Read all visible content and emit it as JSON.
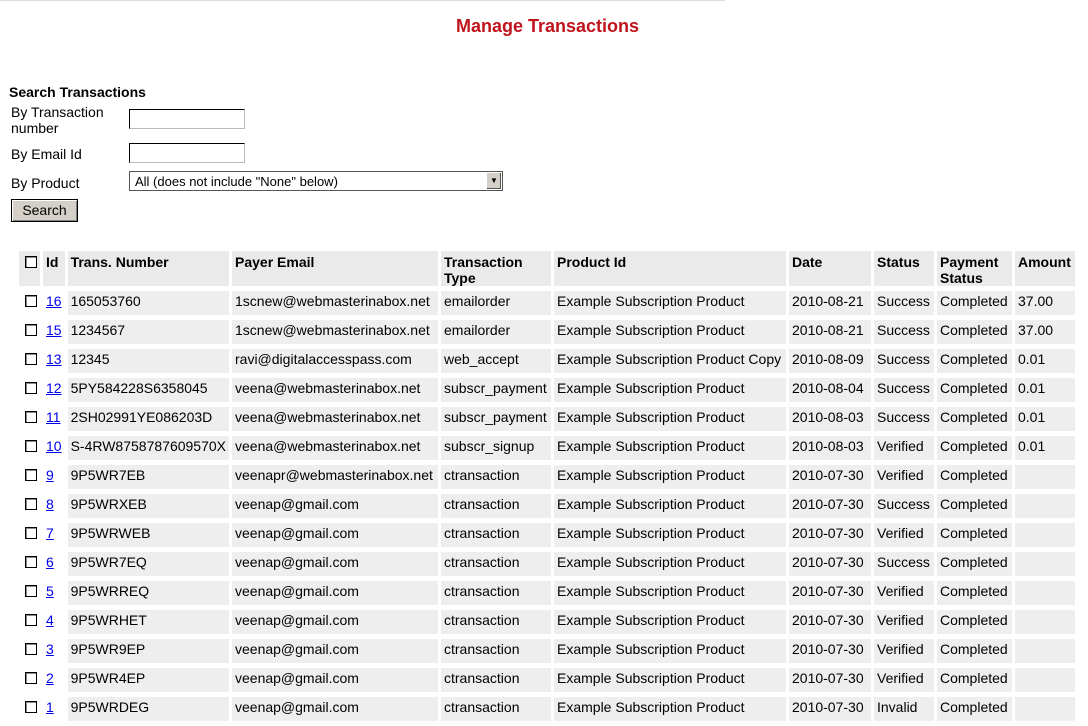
{
  "page": {
    "title": "Manage Transactions"
  },
  "search": {
    "heading": "Search Transactions",
    "transaction_label": "By Transaction number",
    "transaction_value": "",
    "email_label": "By Email Id",
    "email_value": "",
    "product_label": "By Product",
    "product_selected": "All (does not include \"None\" below)",
    "button_label": "Search"
  },
  "table": {
    "headers": [
      "Id",
      "Trans. Number",
      "Payer Email",
      "Transaction Type",
      "Product Id",
      "Date",
      "Status",
      "Payment Status",
      "Amount"
    ],
    "rows": [
      [
        "16",
        "165053760",
        "1scnew@webmasterinabox.net",
        "emailorder",
        "Example Subscription Product",
        "2010-08-21",
        "Success",
        "Completed",
        "37.00"
      ],
      [
        "15",
        "1234567",
        "1scnew@webmasterinabox.net",
        "emailorder",
        "Example Subscription Product",
        "2010-08-21",
        "Success",
        "Completed",
        "37.00"
      ],
      [
        "13",
        "12345",
        "ravi@digitalaccesspass.com",
        "web_accept",
        "Example Subscription Product Copy",
        "2010-08-09",
        "Success",
        "Completed",
        "0.01"
      ],
      [
        "12",
        "5PY584228S6358045",
        "veena@webmasterinabox.net",
        "subscr_payment",
        "Example Subscription Product",
        "2010-08-04",
        "Success",
        "Completed",
        "0.01"
      ],
      [
        "11",
        "2SH02991YE086203D",
        "veena@webmasterinabox.net",
        "subscr_payment",
        "Example Subscription Product",
        "2010-08-03",
        "Success",
        "Completed",
        "0.01"
      ],
      [
        "10",
        "S-4RW8758787609570X",
        "veena@webmasterinabox.net",
        "subscr_signup",
        "Example Subscription Product",
        "2010-08-03",
        "Verified",
        "Completed",
        "0.01"
      ],
      [
        "9",
        "9P5WR7EB",
        "veenapr@webmasterinabox.net",
        "ctransaction",
        "Example Subscription Product",
        "2010-07-30",
        "Verified",
        "Completed",
        ""
      ],
      [
        "8",
        "9P5WRXEB",
        "veenap@gmail.com",
        "ctransaction",
        "Example Subscription Product",
        "2010-07-30",
        "Success",
        "Completed",
        ""
      ],
      [
        "7",
        "9P5WRWEB",
        "veenap@gmail.com",
        "ctransaction",
        "Example Subscription Product",
        "2010-07-30",
        "Verified",
        "Completed",
        ""
      ],
      [
        "6",
        "9P5WR7EQ",
        "veenap@gmail.com",
        "ctransaction",
        "Example Subscription Product",
        "2010-07-30",
        "Success",
        "Completed",
        ""
      ],
      [
        "5",
        "9P5WRREQ",
        "veenap@gmail.com",
        "ctransaction",
        "Example Subscription Product",
        "2010-07-30",
        "Verified",
        "Completed",
        ""
      ],
      [
        "4",
        "9P5WRHET",
        "veenap@gmail.com",
        "ctransaction",
        "Example Subscription Product",
        "2010-07-30",
        "Verified",
        "Completed",
        ""
      ],
      [
        "3",
        "9P5WR9EP",
        "veenap@gmail.com",
        "ctransaction",
        "Example Subscription Product",
        "2010-07-30",
        "Verified",
        "Completed",
        ""
      ],
      [
        "2",
        "9P5WR4EP",
        "veenap@gmail.com",
        "ctransaction",
        "Example Subscription Product",
        "2010-07-30",
        "Verified",
        "Completed",
        ""
      ],
      [
        "1",
        "9P5WRDEG",
        "veenap@gmail.com",
        "ctransaction",
        "Example Subscription Product",
        "2010-07-30",
        "Invalid",
        "Completed",
        ""
      ]
    ]
  },
  "colors": {
    "title": "#c0141d",
    "link": "#0000ee",
    "cell_bg": "#eeeeee"
  }
}
